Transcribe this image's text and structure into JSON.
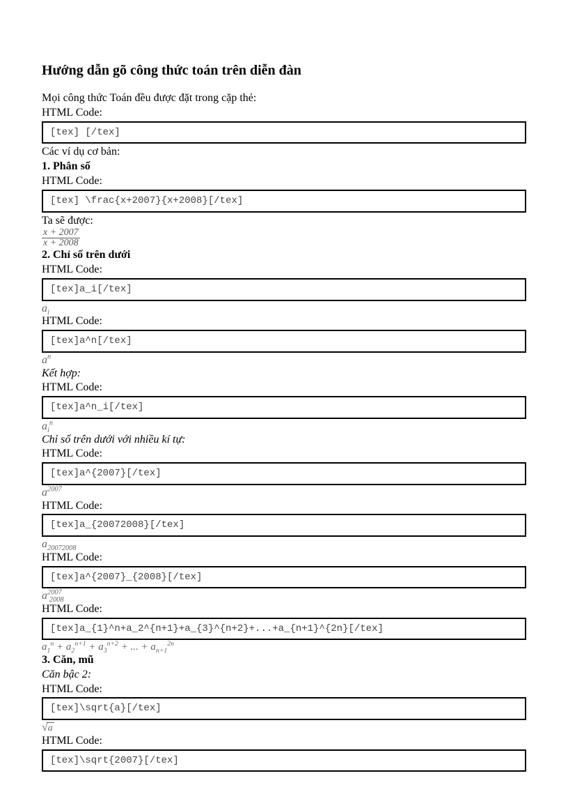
{
  "title": "Hướng dẫn gõ công thức toán trên diễn đàn",
  "intro": "Mọi công thức Toán đều được đặt trong cặp thẻ:",
  "html_code_label": "HTML Code:",
  "code1": "[tex] [/tex]",
  "examples_intro": "Các ví dụ cơ bản:",
  "sec1": {
    "heading": "1. Phân số",
    "code": "[tex] \\frac{x+2007}{x+2008}[/tex]",
    "result_label": "Ta sẽ được:",
    "frac_num": "x + 2007",
    "frac_den": "x + 2008"
  },
  "sec2": {
    "heading": "2. Chỉ số trên dưới",
    "code_sub": "[tex]a_i[/tex]",
    "render_sub": "a",
    "render_sub_i": "i",
    "code_sup": "[tex]a^n[/tex]",
    "render_sup": "a",
    "render_sup_n": "n",
    "combine_label": "Kết hợp:",
    "code_combine": "[tex]a^n_i[/tex]",
    "multi_label": "Chỉ số trên dưới với nhiều kí tự:",
    "code_a2007": "[tex]a^{2007}[/tex]",
    "render_a2007": "a",
    "render_a2007_sup": "2007",
    "code_a20072008": "[tex]a_{20072008}[/tex]",
    "render_a20072008": "a",
    "render_a20072008_sub": "20072008",
    "code_aboth": "[tex]a^{2007}_{2008}[/tex]",
    "render_aboth": "a",
    "render_aboth_sup": "2007",
    "render_aboth_sub": "2008",
    "code_series": "[tex]a_{1}^n+a_2^{n+1}+a_{3}^{n+2}+...+a_{n+1}^{2n}[/tex]",
    "series_render": "a₁ⁿ + a₂ⁿ⁺¹ + a₃ⁿ⁺² + ... + aₙ₊₁²ⁿ"
  },
  "sec3": {
    "heading": "3. Căn, mũ",
    "sqrt2_label": "Căn bậc 2:",
    "code_sqrta": "[tex]\\sqrt{a}[/tex]",
    "render_sqrta": "a",
    "code_sqrt2007": "[tex]\\sqrt{2007}[/tex]"
  }
}
